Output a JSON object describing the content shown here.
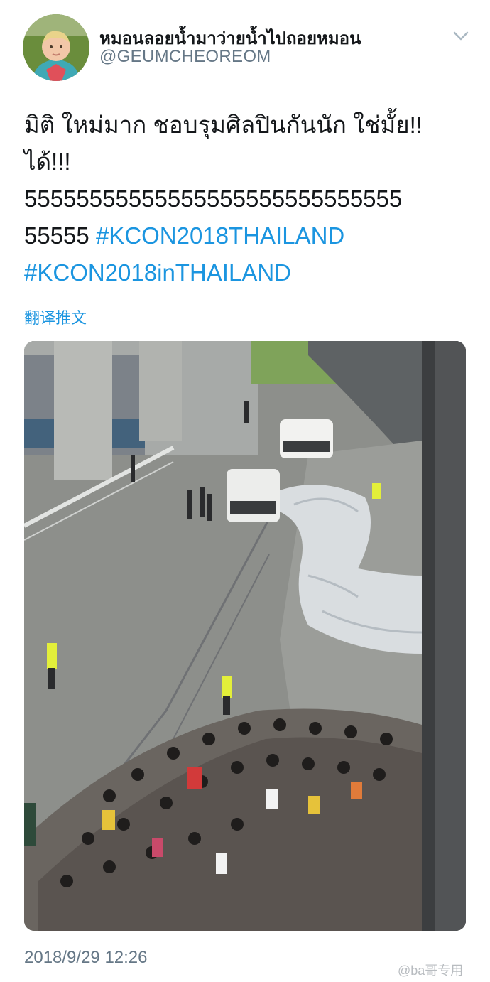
{
  "tweet": {
    "author": {
      "display_name": "หมอนลอยน้ำมาว่ายน้ำไปถอยหมอน",
      "handle": "@GEUMCHEOREOM"
    },
    "menu_icon": "chevron-down-icon",
    "text": {
      "line1": "มิติ ใหม่มาก ชอบรุมศิลปินกันนัก ใช่มั้ย!!",
      "line2": "ได้!!!",
      "line3": "55555555555555555555555555555",
      "line4_plain": "55555 ",
      "hashtag1": "#KCON2018THAILAND",
      "hashtag2": "#KCON2018inTHAILAND"
    },
    "translate_label": "翻译推文",
    "timestamp": "2018/9/29 12:26"
  },
  "watermark": "@ba哥专用",
  "colors": {
    "link": "#1b95e0",
    "secondary_text": "#657786",
    "primary_text": "#14171a"
  }
}
